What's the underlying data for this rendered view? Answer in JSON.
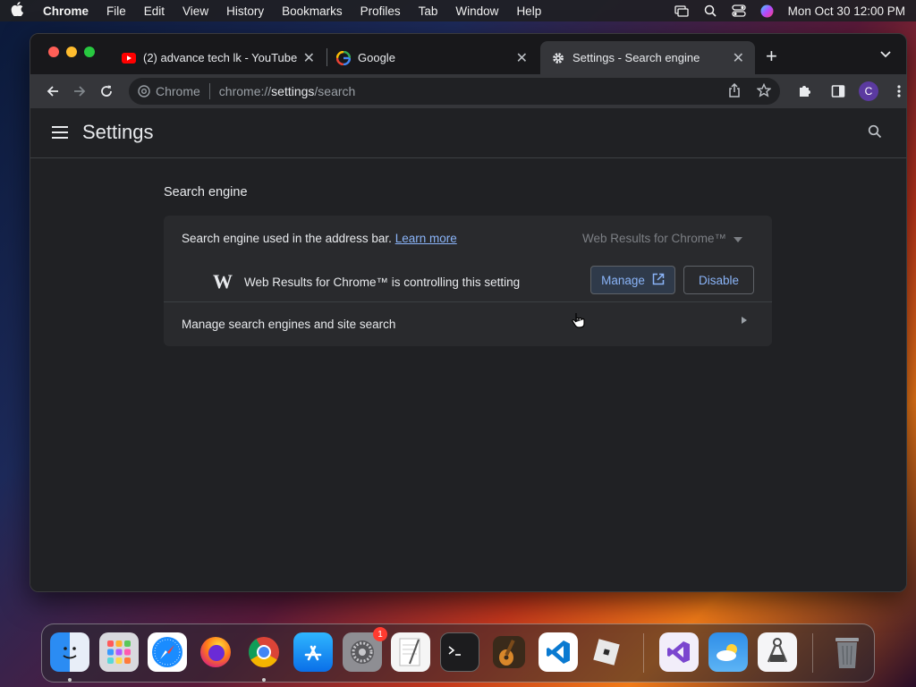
{
  "menubar": {
    "app": "Chrome",
    "items": [
      "File",
      "Edit",
      "View",
      "History",
      "Bookmarks",
      "Profiles",
      "Tab",
      "Window",
      "Help"
    ],
    "clock": "Mon Oct 30  12:00 PM"
  },
  "tabs": [
    {
      "title": "(2) advance tech lk - YouTube",
      "icon": "youtube-icon"
    },
    {
      "title": "Google",
      "icon": "google-icon"
    },
    {
      "title": "Settings - Search engine",
      "icon": "gear-icon",
      "active": true
    }
  ],
  "omnibox": {
    "chip_label": "Chrome",
    "url_prefix": "chrome://",
    "url_bold": "settings",
    "url_suffix": "/search"
  },
  "profile_initial": "C",
  "settings": {
    "title": "Settings",
    "section_title": "Search engine",
    "address_bar_label": "Search engine used in the address bar.",
    "learn_more": "Learn more",
    "selected_engine": "Web Results for Chrome™",
    "controlling_text": "Web Results for Chrome™ is controlling this setting",
    "manage_label": "Manage",
    "disable_label": "Disable",
    "manage_engines_label": "Manage search engines and site search"
  },
  "dock": {
    "apps": [
      "Finder",
      "Launchpad",
      "Safari",
      "Firefox",
      "Chrome",
      "App Store",
      "System Settings",
      "TextEdit",
      "Terminal",
      "GarageBand",
      "VS Code",
      "Roblox",
      "Visual Studio",
      "Weather",
      "Instruments",
      "Trash"
    ],
    "settings_badge": "1"
  }
}
